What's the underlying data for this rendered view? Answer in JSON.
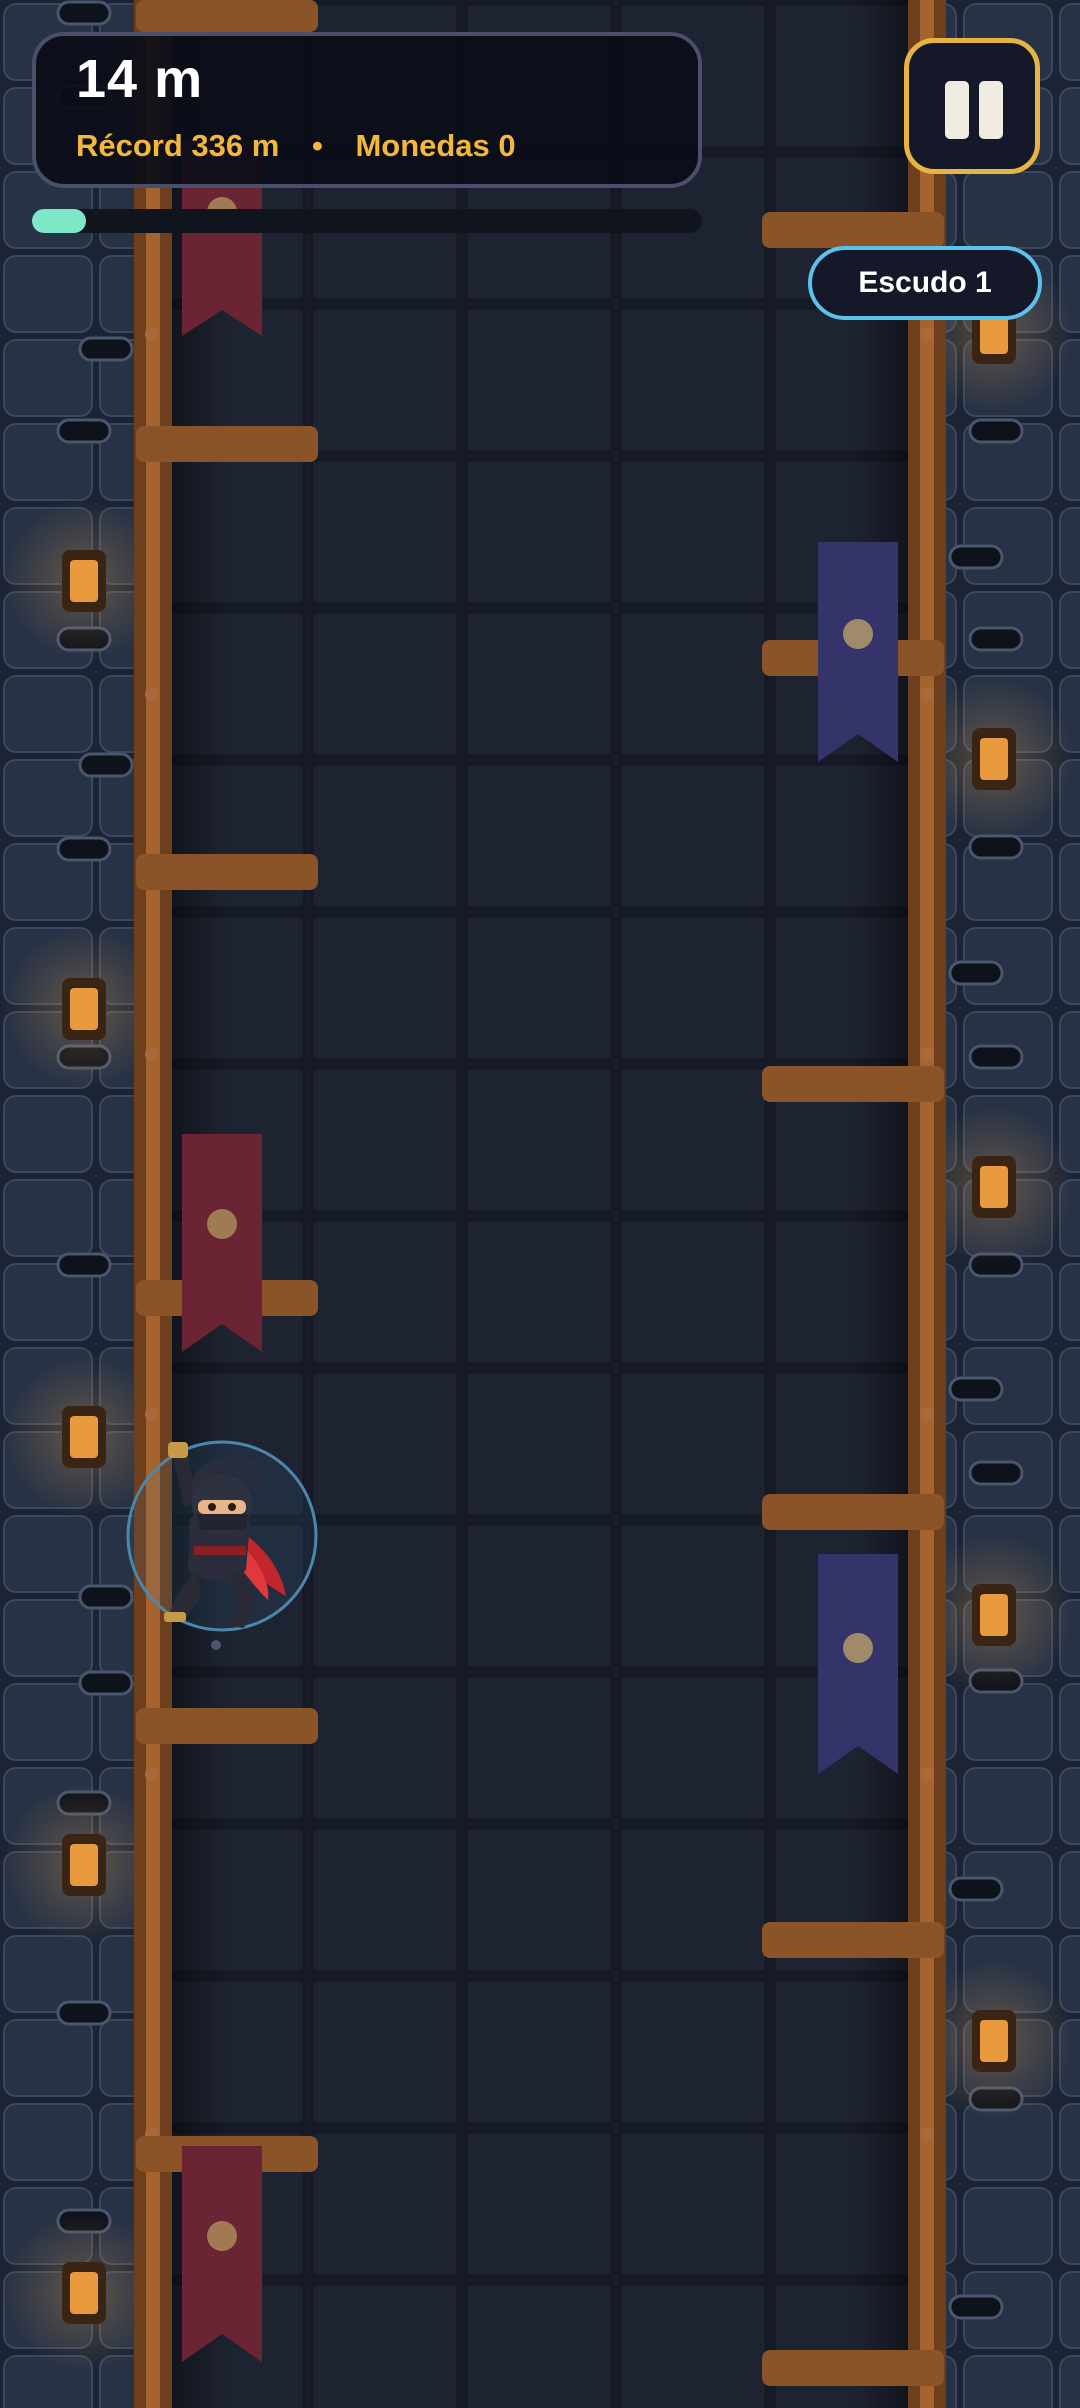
{
  "hud": {
    "height_text": "14 m",
    "record_text": "Récord 336 m",
    "separator": "•",
    "coins_text": "Monedas 0",
    "progress_fraction": 0.08
  },
  "controls": {
    "pause_icon": "pause-icon",
    "shield_label": "Escudo 1"
  },
  "scene": {
    "character": "ninja climber with red scarf inside a blue shield bubble",
    "colors": {
      "background": "#1b2232",
      "inner_wall": "#1e2331",
      "pole": "#8c5226",
      "ledge": "#8a5428",
      "lamp": "#e89a3c",
      "banner_red": "#6b2434",
      "banner_blue": "#34346a",
      "accent_gold": "#f2b83c",
      "accent_cyan": "#5bc2ea",
      "progress": "#7de8c8"
    }
  }
}
